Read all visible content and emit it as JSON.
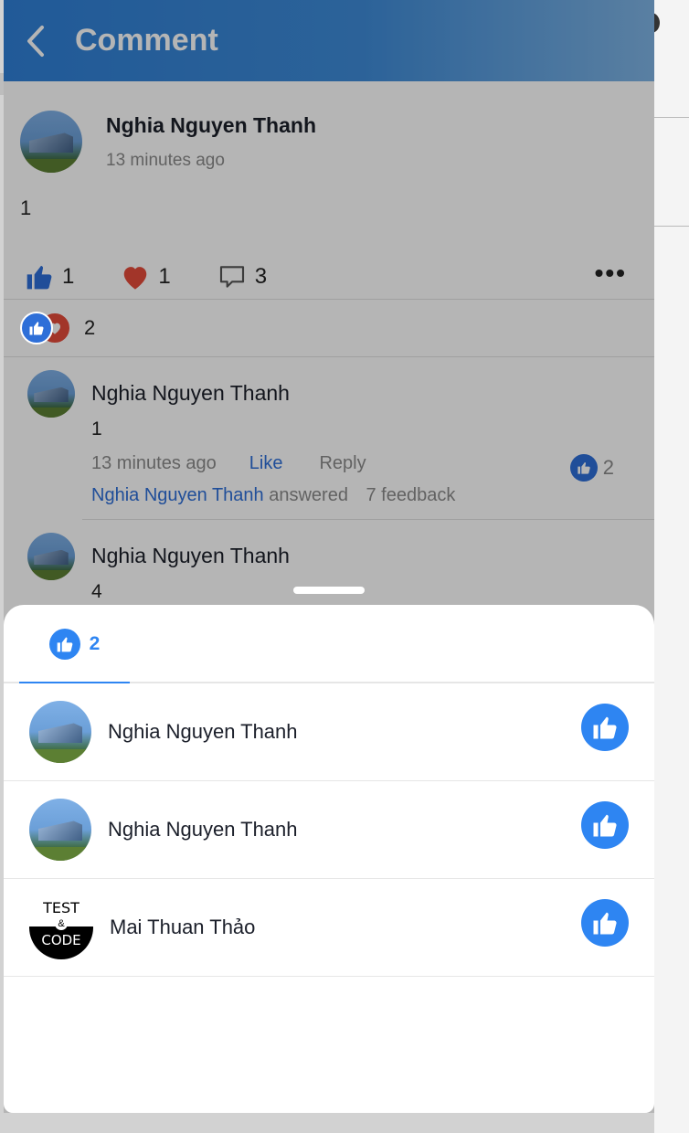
{
  "header": {
    "title": "Comment"
  },
  "post": {
    "author": "Nghia  Nguyen Thanh",
    "time": "13 minutes ago",
    "body": "1",
    "likes": "1",
    "hearts": "1",
    "comments": "3",
    "more": "•••",
    "reaction_total": "2"
  },
  "comments": [
    {
      "author": "Nghia  Nguyen Thanh",
      "text": "1",
      "time": "13 minutes ago",
      "like_label": "Like",
      "reply_label": "Reply",
      "reaction_count": "2",
      "answered_by": "Nghia  Nguyen Thanh",
      "answered_label": "answered",
      "feedback": "7  feedback"
    },
    {
      "author": "Nghia  Nguyen Thanh",
      "text": "4"
    }
  ],
  "sheet": {
    "tab_count": "2",
    "users": [
      {
        "name": "Nghia  Nguyen Thanh"
      },
      {
        "name": "Nghia  Nguyen Thanh"
      },
      {
        "name": "Mai Thuan Thảo",
        "logo_top": "TEST",
        "logo_amp": "&",
        "logo_bottom": "CODE"
      }
    ]
  },
  "colors": {
    "accent": "#2e85f2",
    "like_blue": "#2e6fd8",
    "heart_red": "#e44b3a",
    "header_start": "#2f7fd6",
    "header_end": "#7fb4e4"
  }
}
